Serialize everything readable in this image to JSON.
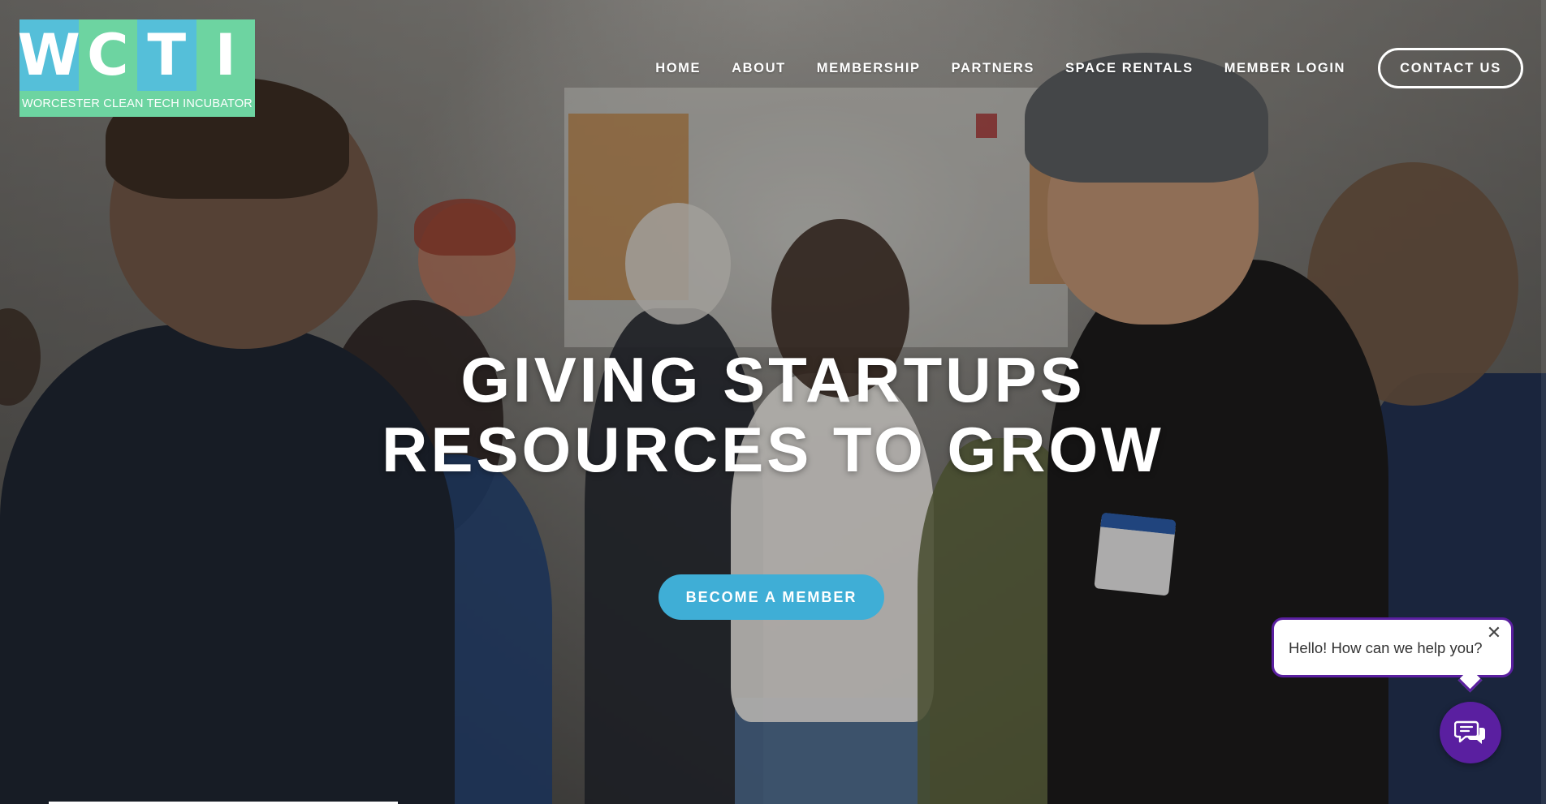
{
  "logo": {
    "letters": [
      "W",
      "C",
      "T",
      "I"
    ],
    "subtitle": "WORCESTER CLEAN TECH INCUBATOR",
    "colors": {
      "teal": "#55bfd9",
      "green": "#6dd4a1"
    }
  },
  "nav": {
    "items": [
      {
        "label": "HOME"
      },
      {
        "label": "ABOUT"
      },
      {
        "label": "MEMBERSHIP"
      },
      {
        "label": "PARTNERS"
      },
      {
        "label": "SPACE RENTALS"
      },
      {
        "label": "MEMBER LOGIN"
      }
    ],
    "contact_label": "CONTACT US"
  },
  "hero": {
    "title_line1": "GIVING STARTUPS",
    "title_line2": "RESOURCES TO GROW",
    "cta_label": "BECOME A MEMBER",
    "cta_color": "#3faed6"
  },
  "chat": {
    "greeting": "Hello! How can we help you?",
    "close_glyph": "✕",
    "launcher_icon": "chat-bubbles-icon",
    "accent": "#5a1fa0"
  }
}
